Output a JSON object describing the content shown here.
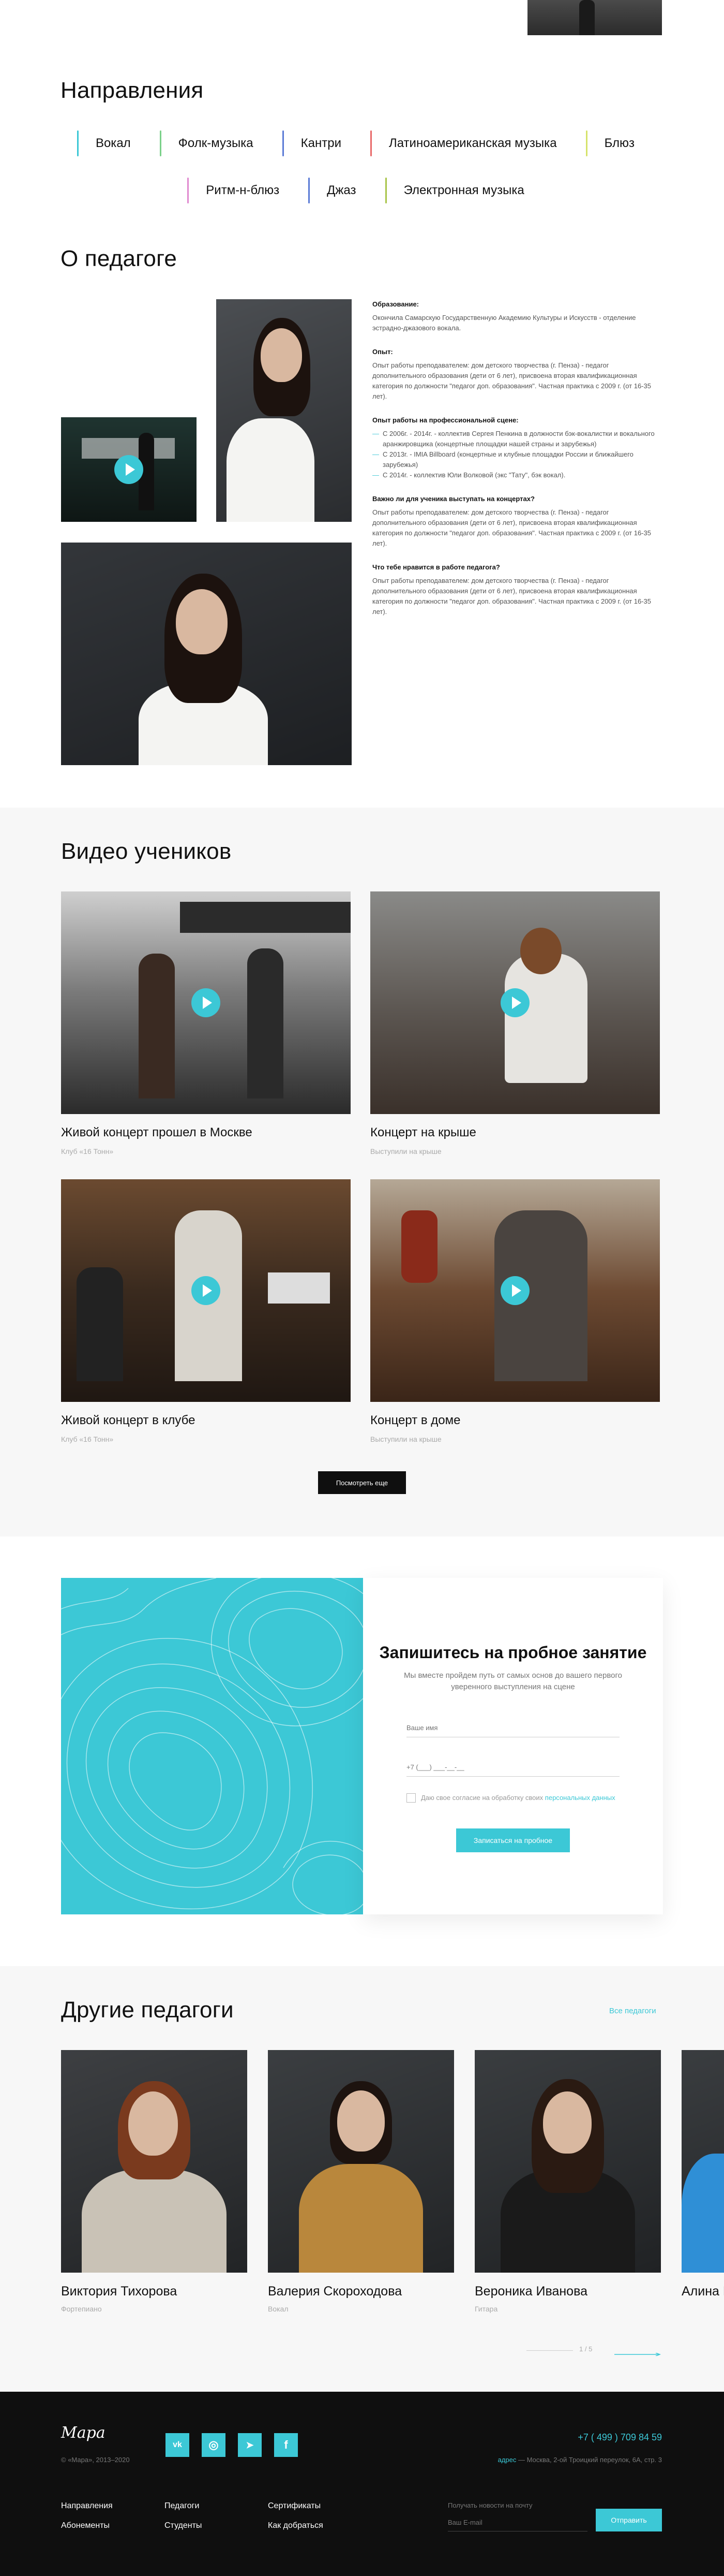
{
  "directions": {
    "title": "Направления",
    "items": [
      {
        "label": "Вокал",
        "color": "#3cc8d6"
      },
      {
        "label": "Фолк-музыка",
        "color": "#7bd18a"
      },
      {
        "label": "Кантри",
        "color": "#5b7bd6"
      },
      {
        "label": "Латиноамериканская музыка",
        "color": "#e86a6a"
      },
      {
        "label": "Блюз",
        "color": "#d6e36a"
      },
      {
        "label": "Ритм-н-блюз",
        "color": "#e08ad0"
      },
      {
        "label": "Джаз",
        "color": "#5b7bd6"
      },
      {
        "label": "Электронная музыка",
        "color": "#a9c54a"
      }
    ]
  },
  "about": {
    "title": "О педагоге",
    "education_label": "Образование:",
    "education_text": "Окончила Самарскую Государственную Академию Культуры и Искусств - отделение эстрадно-джазового вокала.",
    "experience_label": "Опыт:",
    "experience_text": "Опыт работы преподавателем: дом детского творчества (г. Пенза) - педагог дополнительного образования (дети от 6 лет), присвоена вторая квалификационная категория по должности \"педагог доп. образования\". Частная практика с 2009 г. (от 16-35 лет).",
    "stage_label": "Опыт работы на профессиональной сцене:",
    "stage_items": [
      "С 2006г. - 2014г. - коллектив Сергея Пенкина в должности бэк-вокалистки и вокального аранжировщика (концертные площадки нашей страны и зарубежья)",
      "С 2013г. - IMIA Billboard (концертные и клубные площадки России и ближайшего зарубежья)",
      "С 2014г. - коллектив Юли Волковой (экс \"Тату\", бэк вокал)."
    ],
    "q1_label": "Важно ли для ученика выступать на концертах?",
    "q1_text": "Опыт работы преподавателем: дом детского творчества (г. Пенза) - педагог дополнительного образования (дети от 6 лет), присвоена вторая квалификационная категория по должности \"педагог доп. образования\". Частная практика с 2009 г. (от 16-35 лет).",
    "q2_label": "Что тебе нравится в работе педагога?",
    "q2_text": "Опыт работы преподавателем: дом детского творчества (г. Пенза) - педагог дополнительного образования (дети от 6 лет), присвоена вторая квалификационная категория по должности \"педагог доп. образования\". Частная практика с 2009 г. (от 16-35 лет)."
  },
  "videos": {
    "title": "Видео учеников",
    "items": [
      {
        "title": "Живой концерт прошел в Москве",
        "subtitle": "Клуб «16 Тонн»"
      },
      {
        "title": "Концерт на крыше",
        "subtitle": "Выступили на крыше"
      },
      {
        "title": "Живой концерт в клубе",
        "subtitle": "Клуб «16 Тонн»"
      },
      {
        "title": "Концерт в доме",
        "subtitle": "Выступили на крыше"
      }
    ],
    "more_button": "Посмотреть еще"
  },
  "trial": {
    "title": "Запишитесь на пробное занятие",
    "subtitle": "Мы вместе пройдем путь от самых основ до вашего первого уверенного выступления на сцене",
    "name_placeholder": "Ваше имя",
    "phone_placeholder": "+7 (___) ___-__-__",
    "consent_text": "Даю свое согласие на обработку своих ",
    "consent_link": "персональных данных",
    "submit": "Записаться на пробное",
    "accent": "#3cc8d6"
  },
  "teachers": {
    "title": "Другие педагоги",
    "all_link": "Все педагоги",
    "items": [
      {
        "name": "Виктория Тихорова",
        "role": "Фортепиано"
      },
      {
        "name": "Валерия Скороходова",
        "role": "Вокал"
      },
      {
        "name": "Вероника Иванова",
        "role": "Гитара"
      },
      {
        "name": "Алина Б",
        "role": ""
      }
    ],
    "pager": "1 / 5"
  },
  "footer": {
    "logo": "Мара",
    "copyright": "© «Мара», 2013–2020",
    "social": [
      {
        "icon": "vk-icon",
        "glyph": "vk"
      },
      {
        "icon": "instagram-icon",
        "glyph": "◎"
      },
      {
        "icon": "telegram-icon",
        "glyph": "➤"
      },
      {
        "icon": "facebook-icon",
        "glyph": "f"
      }
    ],
    "phone": "+7 ( 499 ) 709 84 59",
    "address_label": "адрес",
    "address": " — Москва, 2-ой Троицкий переулок, 6А, стр. 3",
    "nav": [
      [
        "Направления",
        "Абонементы"
      ],
      [
        "Педагоги",
        "Студенты"
      ],
      [
        "Сертификаты",
        "Как добраться"
      ]
    ],
    "newsletter_label": "Получать новости на почту",
    "email_placeholder": "Ваш E-mail",
    "subscribe": "Отправить"
  }
}
